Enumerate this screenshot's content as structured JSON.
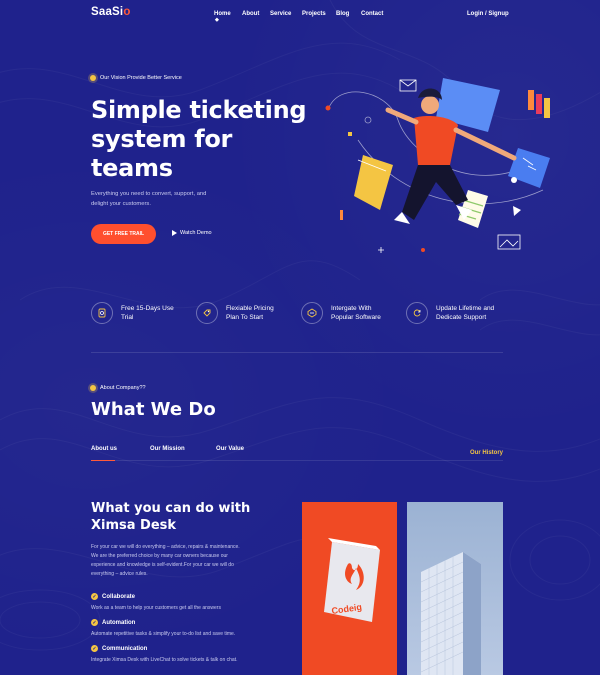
{
  "header": {
    "logo_main": "SaaSi",
    "logo_accent": "o",
    "nav": {
      "home": "Home",
      "about": "About",
      "service": "Service",
      "projects": "Projects",
      "blog": "Blog",
      "contact": "Contact"
    },
    "login": "Login / Signup"
  },
  "hero": {
    "eyebrow": "Our Vision Provide Better Service",
    "title_line1": "Simple ticketing",
    "title_line2": "system for",
    "title_line3": "teams",
    "subtitle_line1": "Everything you need to convert, support, and",
    "subtitle_line2": "delight your customers.",
    "cta": "GET FREE TRAIL",
    "watch": "Watch Demo"
  },
  "features": [
    {
      "line1": "Free 15-Days Use",
      "line2": "Trial",
      "icon": "badge-icon"
    },
    {
      "line1": "Flexiable Pricing",
      "line2": "Plan To Start",
      "icon": "tag-icon"
    },
    {
      "line1": "Intergate With",
      "line2": "Popular Software",
      "icon": "integration-icon"
    },
    {
      "line1": "Update Lifetime and",
      "line2": "Dedicate Support",
      "icon": "refresh-icon"
    }
  ],
  "what_we_do": {
    "eyebrow": "About Company??",
    "title": "What We Do",
    "tabs": [
      "About us",
      "Our Mission",
      "Our Value"
    ],
    "history": "Our History",
    "section_title_line1": "What you can do with",
    "section_title_line2": "Ximsa Desk",
    "desc_line1": "For your car we will do everything – advice, repairs & maintenance.",
    "desc_line2": "We are the preferred choice by many car owners because our",
    "desc_line3": "experience and knowledge is self-evident.For your car we will do",
    "desc_line4": "everything – advice rules.",
    "items": [
      {
        "title": "Collaborate",
        "desc": "Work as a team to help your customers get all the answers"
      },
      {
        "title": "Automation",
        "desc": "Automate repetitive tasks & simplify your to-do list and save time."
      },
      {
        "title": "Communication",
        "desc": "Integrate Ximsa Desk with LiveChat to solve tickets & talk on chat."
      }
    ],
    "card_label": "Codeig"
  },
  "colors": {
    "background": "#1f228c",
    "accent": "#ff4f2e",
    "highlight": "#f4c543"
  }
}
